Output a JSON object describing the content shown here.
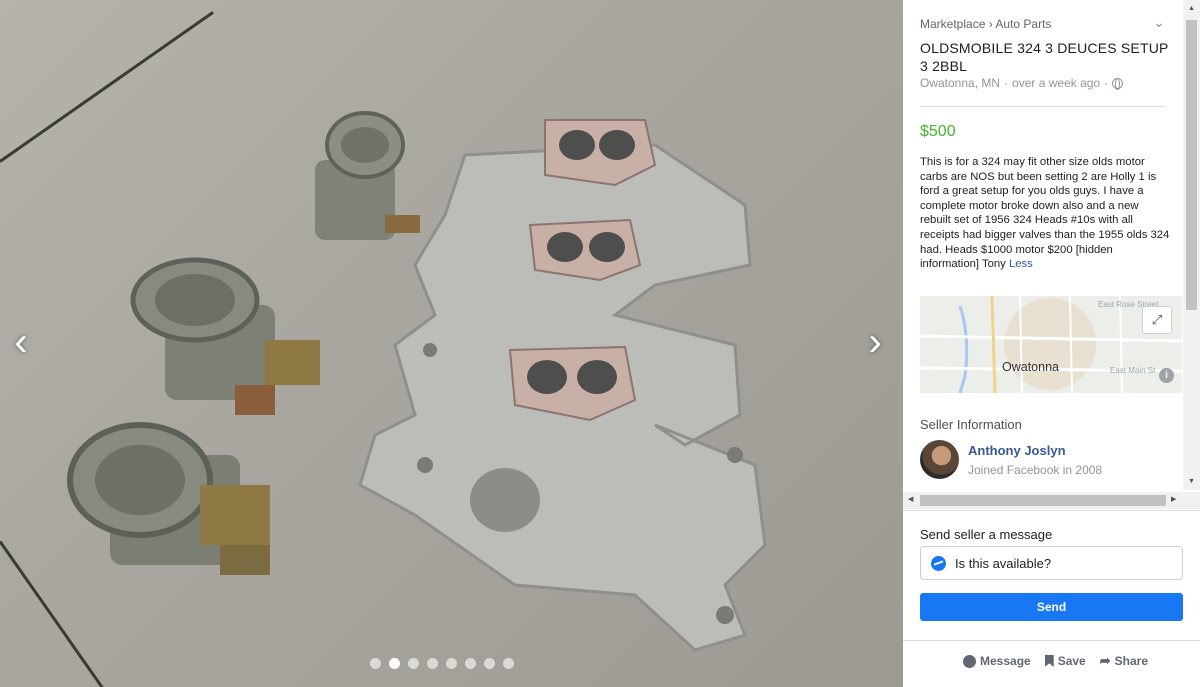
{
  "breadcrumb": {
    "category": "Marketplace",
    "separator": "›",
    "subcategory": "Auto Parts"
  },
  "listing": {
    "title": "OLDSMOBILE 324 3 DEUCES SETUP 3 2BBL",
    "location": "Owatonna, MN",
    "posted": "over a week ago",
    "meta_sep": "·",
    "price": "$500",
    "description": "This is for a 324 may fit other size olds motor carbs are NOS but been setting 2 are Holly 1 is ford a great setup for you olds guys. I have a complete motor broke down also and a new rebuilt set of 1956 324 Heads #10s with all receipts had bigger valves than the 1955 olds 324 had. Heads $1000 motor $200 [hidden information] Tony",
    "less_link": "Less"
  },
  "map": {
    "city": "Owatonna",
    "street_1": "East Rose Street",
    "street_2": "East Main St"
  },
  "seller": {
    "heading": "Seller Information",
    "name": "Anthony Joslyn",
    "joined": "Joined Facebook in 2008"
  },
  "message": {
    "label": "Send seller a message",
    "value": "Is this available?",
    "send_label": "Send"
  },
  "actions": {
    "message": "Message",
    "save": "Save",
    "share": "Share"
  },
  "viewer": {
    "photo_count": 8,
    "active_index": 1
  },
  "colors": {
    "price": "#42b72a",
    "link": "#365899",
    "send_button": "#1877f2"
  }
}
